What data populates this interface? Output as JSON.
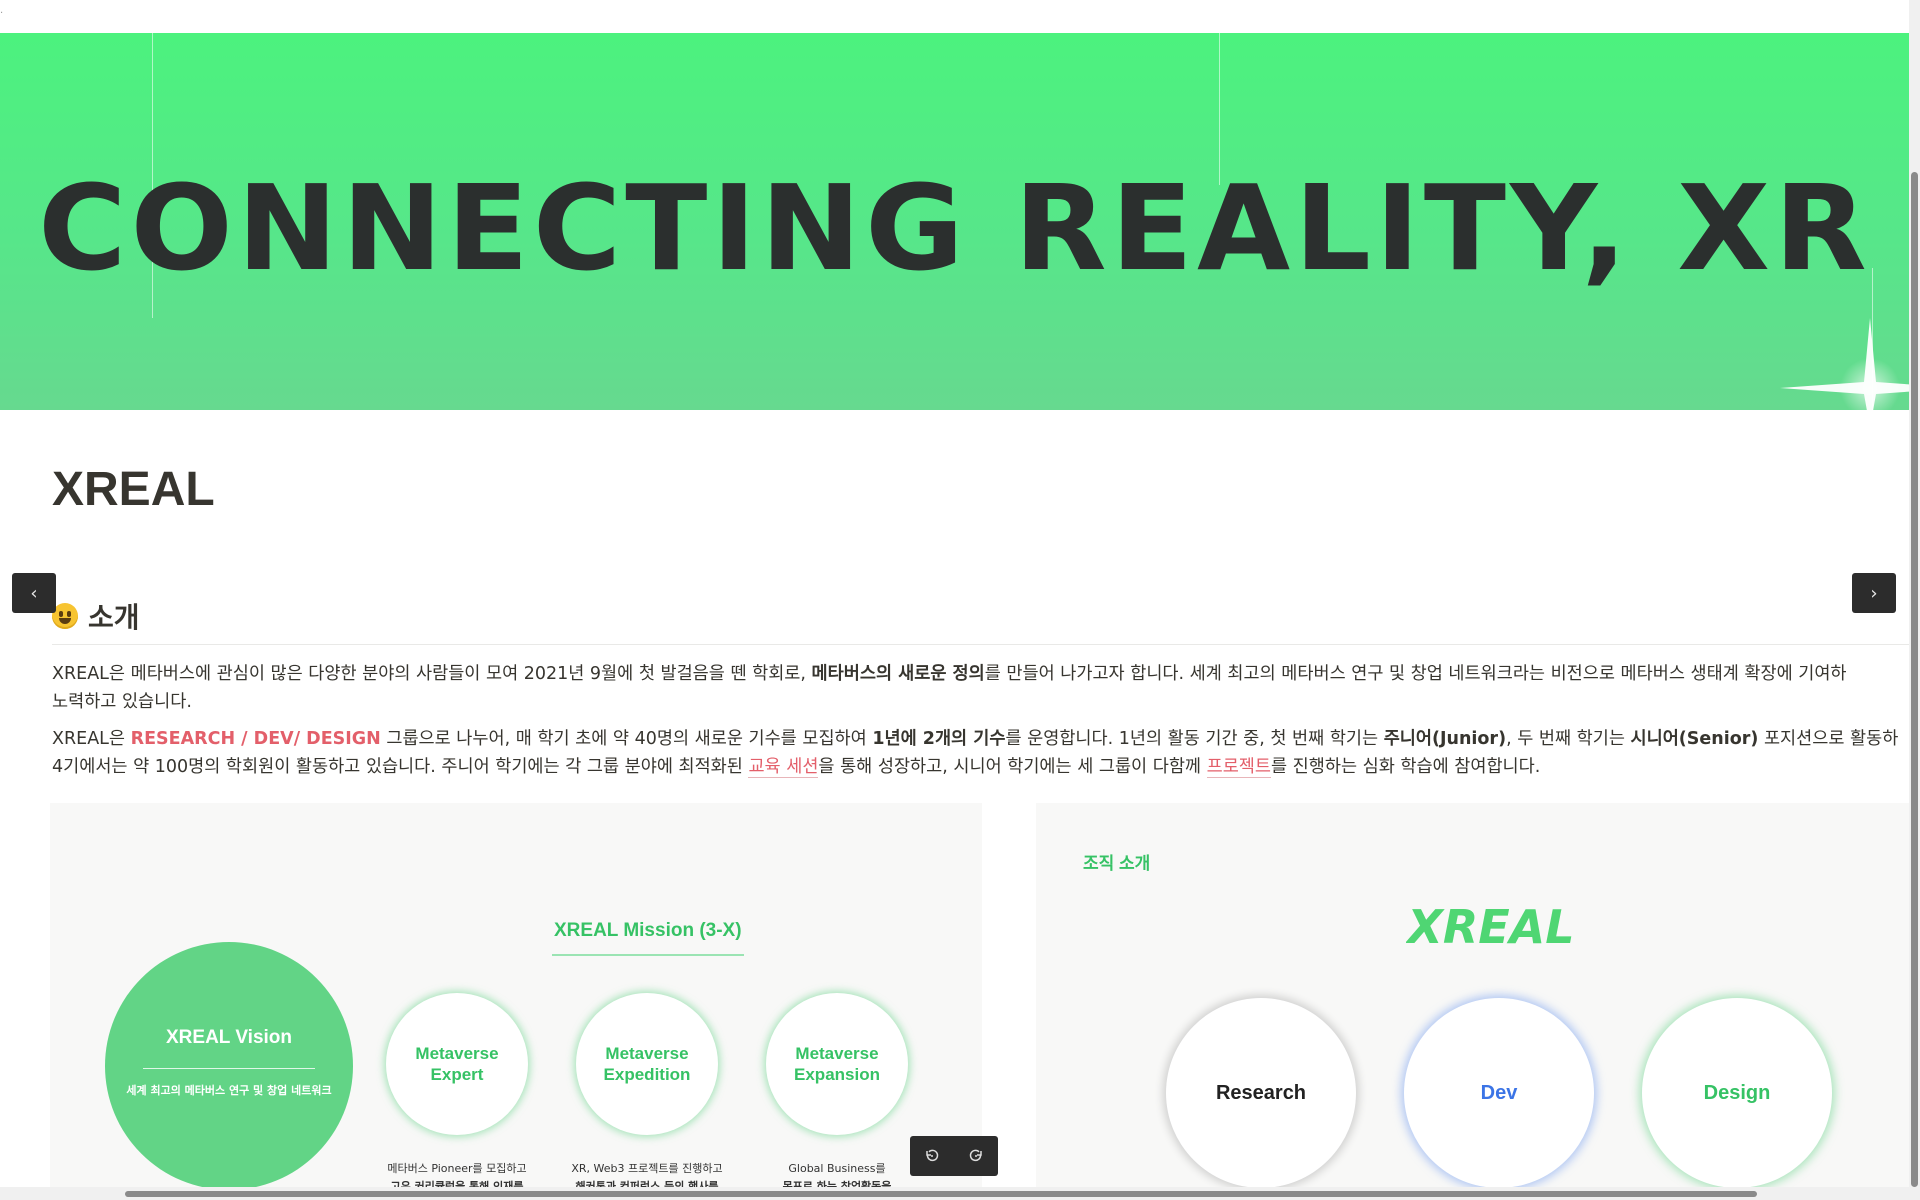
{
  "banner": {
    "title": "CONNECTING REALITY, XR",
    "background_color": "#4cf27e",
    "title_color": "#2b2f2e"
  },
  "page": {
    "title": "XREAL",
    "section_emoji": "grinning-face",
    "section_title": "소개"
  },
  "intro": {
    "p1": {
      "s1": "XREAL은 메타버스에 관심이 많은 다양한 분야의 사람들이 모여 2021년 9월에 첫 발걸음을 뗀 학회로, ",
      "s2": "메타버스의 새로운 정의",
      "s3": "를 만들어 나가고자 합니다. 세계 최고의 메타버스 연구 및 창업 네트워크라는 비전으로 메타버스 생태계 확장에 기여하",
      "s4": "노력하고 있습니다."
    },
    "p2": {
      "s1": "XREAL은 ",
      "s2": "RESEARCH / DEV/ DESIGN",
      "s3": " 그룹으로 나누어, 매 학기 초에 약 40명의 새로운 기수를 모집하여 ",
      "s4": "1년에 2개의 기수",
      "s5": "를 운영합니다. 1년의 활동 기간 중, 첫 번째 학기는 ",
      "s6": "주니어(Junior)",
      "s7": ", 두 번째 학기는 ",
      "s8": "시니어(Senior)",
      "s9": " 포지션으로 활동하",
      "s10": "4기에서는 약 100명의 학회원이 활동하고 있습니다. 주니어 학기에는 각 그룹 분야에 최적화된 ",
      "s11": "교육 세션",
      "s12": "을 통해 성장하고, 시니어 학기에는 세 그룹이 다함께 ",
      "s13": "프로젝트",
      "s14": "를 진행하는 심화 학습에 참여합니다."
    },
    "accent_color": "#e35f6a"
  },
  "mission_card": {
    "title": "XREAL Mission (3-X)",
    "vision_title": "XREAL Vision",
    "vision_subtitle": "세계 최고의 메타버스 연구 및 창업 네트워크",
    "missions": [
      {
        "label": "Metaverse Expert",
        "desc1": "메타버스 Pioneer를 모집하고",
        "desc2": "고유 커리큘럼을 통해 인재를"
      },
      {
        "label": "Metaverse Expedition",
        "desc1": "XR, Web3 프로젝트를 진행하고",
        "desc2": "해커톤과 컨퍼런스 등의 행사를"
      },
      {
        "label": "Metaverse Expansion",
        "desc1": "Global Business를",
        "desc2": "목표로 하는 창업활동을"
      }
    ],
    "accent_color": "#36c265"
  },
  "org_card": {
    "label": "조직 소개",
    "logo_text": "XREAL",
    "groups": [
      "Research",
      "Dev",
      "Design"
    ],
    "group_colors": [
      "#222222",
      "#3b74e6",
      "#36c265"
    ]
  },
  "viewer": {
    "prev_icon": "‹",
    "next_icon": "›"
  }
}
